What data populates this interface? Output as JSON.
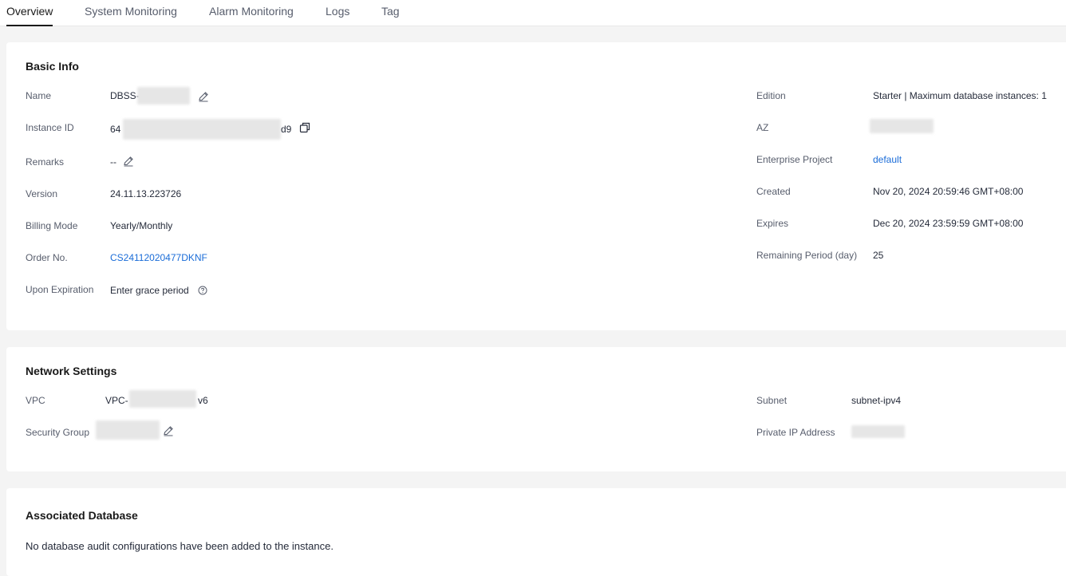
{
  "tabs": [
    {
      "label": "Overview",
      "active": true
    },
    {
      "label": "System Monitoring",
      "active": false
    },
    {
      "label": "Alarm Monitoring",
      "active": false
    },
    {
      "label": "Logs",
      "active": false
    },
    {
      "label": "Tag",
      "active": false
    }
  ],
  "basic_info": {
    "title": "Basic Info",
    "name_label": "Name",
    "name_value": "DBSS-",
    "instance_id_label": "Instance ID",
    "instance_id_prefix": "64",
    "instance_id_suffix": "d9",
    "remarks_label": "Remarks",
    "remarks_value": "--",
    "version_label": "Version",
    "version_value": "24.11.13.223726",
    "billing_label": "Billing Mode",
    "billing_value": "Yearly/Monthly",
    "order_label": "Order No.",
    "order_value": "CS24112020477DKNF",
    "expiration_label": "Upon Expiration",
    "expiration_value": "Enter grace period",
    "edition_label": "Edition",
    "edition_value": "Starter | Maximum database instances: 1",
    "az_label": "AZ",
    "enterprise_label": "Enterprise Project",
    "enterprise_value": "default",
    "created_label": "Created",
    "created_value": "Nov 20, 2024 20:59:46 GMT+08:00",
    "expires_label": "Expires",
    "expires_value": "Dec 20, 2024 23:59:59 GMT+08:00",
    "remaining_label": "Remaining Period (day)",
    "remaining_value": "25"
  },
  "network": {
    "title": "Network Settings",
    "vpc_label": "VPC",
    "vpc_prefix": "VPC-",
    "vpc_suffix": "v6",
    "sg_label": "Security Group",
    "subnet_label": "Subnet",
    "subnet_value": "subnet-ipv4",
    "ip_label": "Private IP Address"
  },
  "associated": {
    "title": "Associated Database",
    "empty_text": "No database audit configurations have been added to the instance."
  },
  "colors": {
    "link": "#1a6cd8",
    "active_tab_underline": "#191919",
    "page_bg": "#f4f4f4"
  },
  "icons": [
    "edit-icon",
    "copy-icon",
    "help-icon"
  ]
}
